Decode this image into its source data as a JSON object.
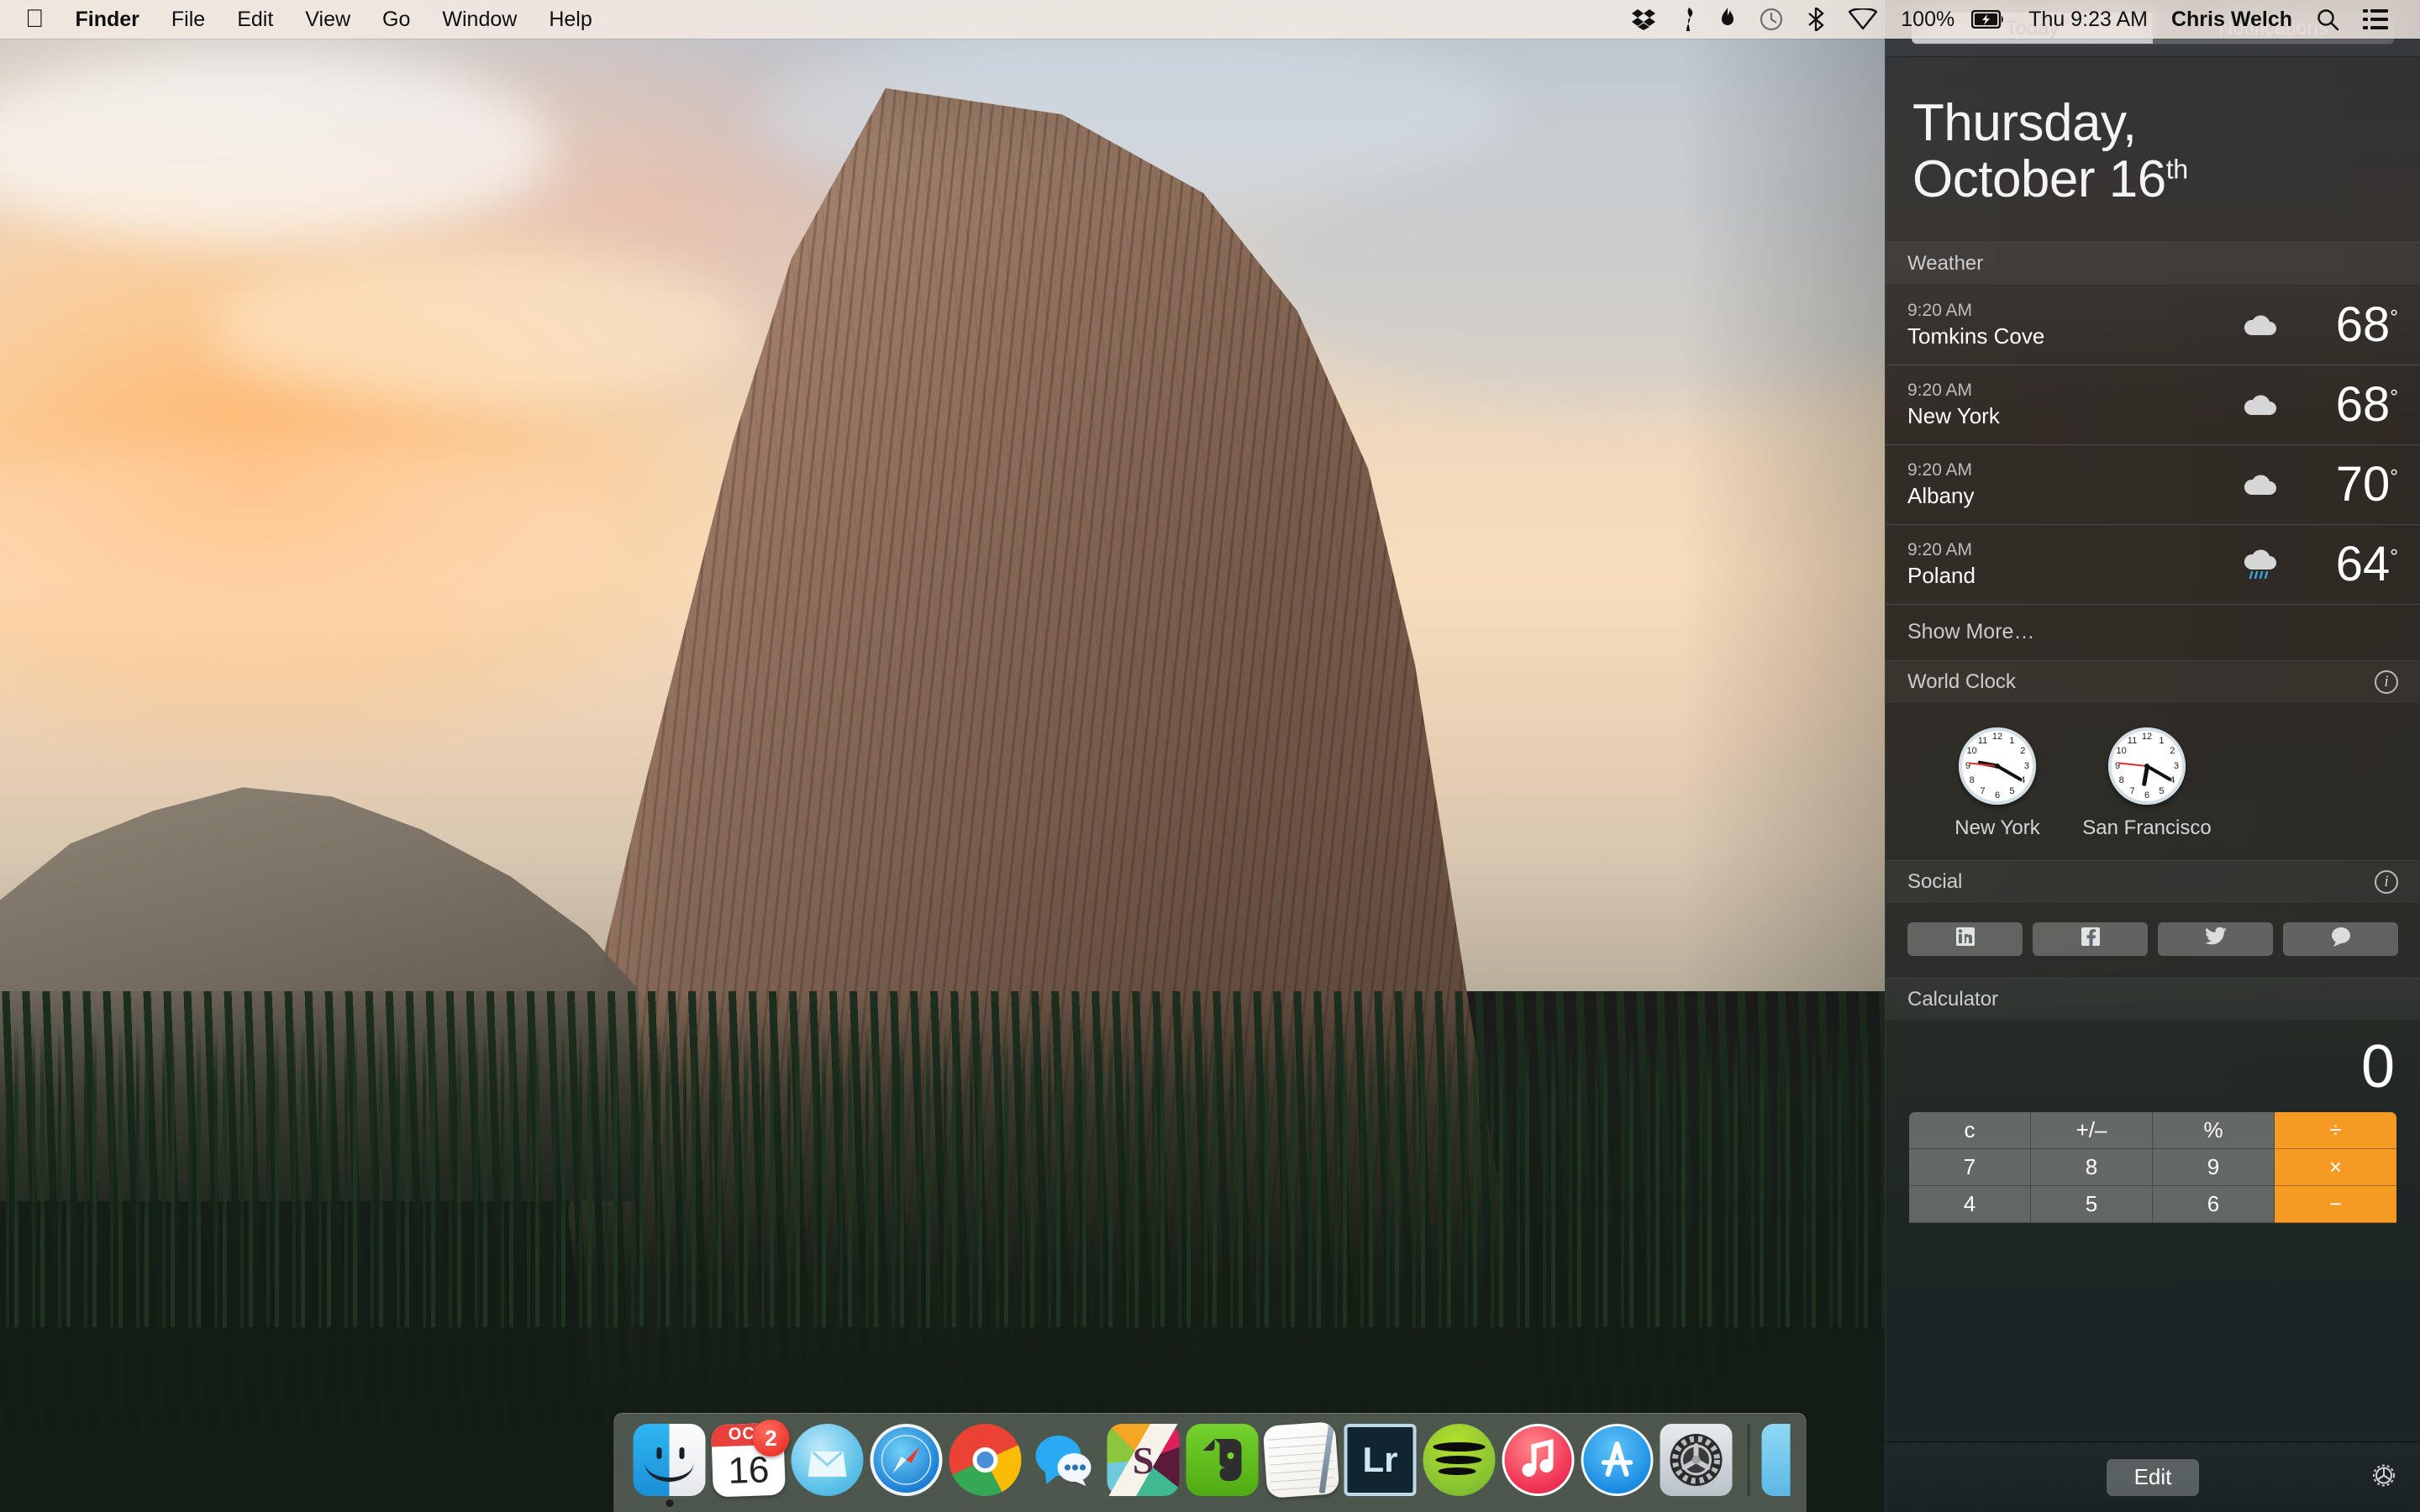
{
  "menubar": {
    "apple_logo": "apple-logo",
    "items": [
      {
        "label": "Finder",
        "bold": true
      },
      {
        "label": "File",
        "bold": false
      },
      {
        "label": "Edit",
        "bold": false
      },
      {
        "label": "View",
        "bold": false
      },
      {
        "label": "Go",
        "bold": false
      },
      {
        "label": "Window",
        "bold": false
      },
      {
        "label": "Help",
        "bold": false
      }
    ],
    "status_icons": [
      "dropbox-icon",
      "wrench-icon",
      "flame-icon",
      "time-machine-icon",
      "bluetooth-icon",
      "wifi-icon"
    ],
    "battery_percent": "100%",
    "battery_icon": "battery-charging-icon",
    "clock": "Thu 9:23 AM",
    "user": "Chris Welch",
    "search_icon": "search-icon",
    "notification_center_icon": "notification-center-icon"
  },
  "dock": {
    "items": [
      {
        "name": "finder",
        "label": "Finder",
        "running": true,
        "badge": null
      },
      {
        "name": "calendar",
        "label": "Calendar",
        "running": false,
        "badge": "2",
        "month": "OCT",
        "day": "16"
      },
      {
        "name": "mailbox",
        "label": "Mailbox",
        "running": false,
        "badge": null
      },
      {
        "name": "safari",
        "label": "Safari",
        "running": false,
        "badge": null
      },
      {
        "name": "chrome",
        "label": "Google Chrome",
        "running": false,
        "badge": null
      },
      {
        "name": "messages",
        "label": "Messages",
        "running": false,
        "badge": null
      },
      {
        "name": "slack",
        "label": "Slack",
        "running": false,
        "badge": null,
        "glyph": "S"
      },
      {
        "name": "evernote",
        "label": "Evernote",
        "running": false,
        "badge": null
      },
      {
        "name": "notes",
        "label": "Notes",
        "running": false,
        "badge": null
      },
      {
        "name": "lightroom",
        "label": "Adobe Lightroom",
        "running": false,
        "badge": null,
        "glyph": "Lr"
      },
      {
        "name": "spotify",
        "label": "Spotify",
        "running": false,
        "badge": null
      },
      {
        "name": "itunes",
        "label": "iTunes",
        "running": false,
        "badge": null
      },
      {
        "name": "appstore",
        "label": "App Store",
        "running": false,
        "badge": null
      },
      {
        "name": "system-preferences",
        "label": "System Preferences",
        "running": false,
        "badge": null
      }
    ]
  },
  "notification_center": {
    "tabs": [
      {
        "label": "Today",
        "active": true
      },
      {
        "label": "Notifications",
        "active": false
      }
    ],
    "date": {
      "weekday": "Thursday,",
      "month_day": "October 16",
      "ordinal": "th"
    },
    "weather": {
      "title": "Weather",
      "rows": [
        {
          "time": "9:20 AM",
          "city": "Tomkins Cove",
          "icon": "cloud-icon",
          "temp": "68",
          "unit": "°"
        },
        {
          "time": "9:20 AM",
          "city": "New York",
          "icon": "cloud-icon",
          "temp": "68",
          "unit": "°"
        },
        {
          "time": "9:20 AM",
          "city": "Albany",
          "icon": "cloud-icon",
          "temp": "70",
          "unit": "°"
        },
        {
          "time": "9:20 AM",
          "city": "Poland",
          "icon": "cloud-rain-icon",
          "temp": "64",
          "unit": "°"
        }
      ],
      "show_more": "Show More…"
    },
    "world_clock": {
      "title": "World Clock",
      "info_icon": "info-icon",
      "clocks": [
        {
          "label": "New York",
          "hour": 9,
          "minute": 20,
          "second": 46
        },
        {
          "label": "San Francisco",
          "hour": 6,
          "minute": 20,
          "second": 46
        }
      ],
      "numerals": [
        "12",
        "1",
        "2",
        "3",
        "4",
        "5",
        "6",
        "7",
        "8",
        "9",
        "10",
        "11"
      ]
    },
    "social": {
      "title": "Social",
      "info_icon": "info-icon",
      "buttons": [
        {
          "name": "linkedin-icon",
          "label": "LinkedIn"
        },
        {
          "name": "facebook-icon",
          "label": "Facebook"
        },
        {
          "name": "twitter-icon",
          "label": "Twitter"
        },
        {
          "name": "message-icon",
          "label": "Message"
        }
      ]
    },
    "calculator": {
      "title": "Calculator",
      "display": "0",
      "keys": [
        {
          "label": "c",
          "op": false
        },
        {
          "label": "+/–",
          "op": false
        },
        {
          "label": "%",
          "op": false
        },
        {
          "label": "÷",
          "op": true
        },
        {
          "label": "7",
          "op": false
        },
        {
          "label": "8",
          "op": false
        },
        {
          "label": "9",
          "op": false
        },
        {
          "label": "×",
          "op": true
        },
        {
          "label": "4",
          "op": false
        },
        {
          "label": "5",
          "op": false
        },
        {
          "label": "6",
          "op": false
        },
        {
          "label": "−",
          "op": true
        }
      ]
    },
    "footer": {
      "edit_label": "Edit",
      "settings_icon": "gear-icon"
    }
  },
  "colors": {
    "accent_orange": "#f59a23",
    "panel_bg": "#2e2a26",
    "tab_active": "#d2d4d7",
    "badge_red": "#e5241a"
  }
}
